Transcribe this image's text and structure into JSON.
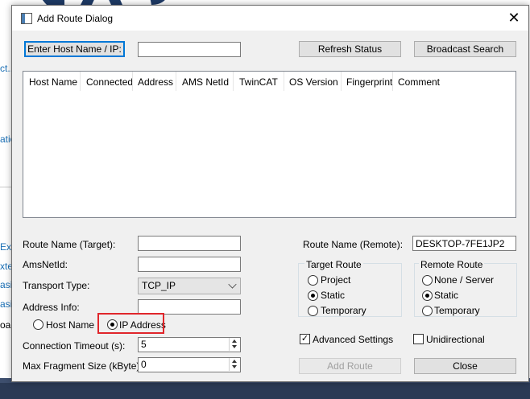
{
  "window": {
    "title": "Add Route Dialog",
    "close_glyph": "✕"
  },
  "top": {
    "enter_host_label": "Enter Host Name / IP:",
    "host_value": "",
    "refresh_label": "Refresh Status",
    "broadcast_label": "Broadcast Search"
  },
  "table": {
    "columns": [
      "Host Name",
      "Connected",
      "Address",
      "AMS NetId",
      "TwinCAT",
      "OS Version",
      "Fingerprint",
      "Comment"
    ],
    "rows": []
  },
  "left_form": {
    "route_name_label": "Route Name (Target):",
    "route_name_value": "",
    "amsnetid_label": "AmsNetId:",
    "amsnetid_value": "",
    "transport_label": "Transport Type:",
    "transport_value": "TCP_IP",
    "address_info_label": "Address Info:",
    "address_info_value": "",
    "host_name_option": "Host Name",
    "ip_address_option": "IP Address",
    "address_mode_selected": "IP Address",
    "timeout_label": "Connection Timeout (s):",
    "timeout_value": "5",
    "fragment_label": "Max Fragment Size (kByte):",
    "fragment_value": "0"
  },
  "right_form": {
    "route_name_remote_label": "Route Name (Remote):",
    "route_name_remote_value": "DESKTOP-7FE1JP2",
    "target_route": {
      "title": "Target Route",
      "options": [
        "Project",
        "Static",
        "Temporary"
      ],
      "selected": "Static"
    },
    "remote_route": {
      "title": "Remote Route",
      "options": [
        "None / Server",
        "Static",
        "Temporary"
      ],
      "selected": "Static"
    },
    "advanced_label": "Advanced Settings",
    "advanced_checked": true,
    "unidirectional_label": "Unidirectional",
    "unidirectional_checked": false,
    "add_route_label": "Add Route",
    "close_label": "Close"
  },
  "background": {
    "side_texts": [
      "ct...",
      "atio",
      "Exte",
      "xter",
      "asic",
      "asic",
      "oad"
    ]
  },
  "colors": {
    "accent": "#0078d7",
    "highlight": "#e0262b",
    "dialog_bg": "#f0f0f0"
  }
}
